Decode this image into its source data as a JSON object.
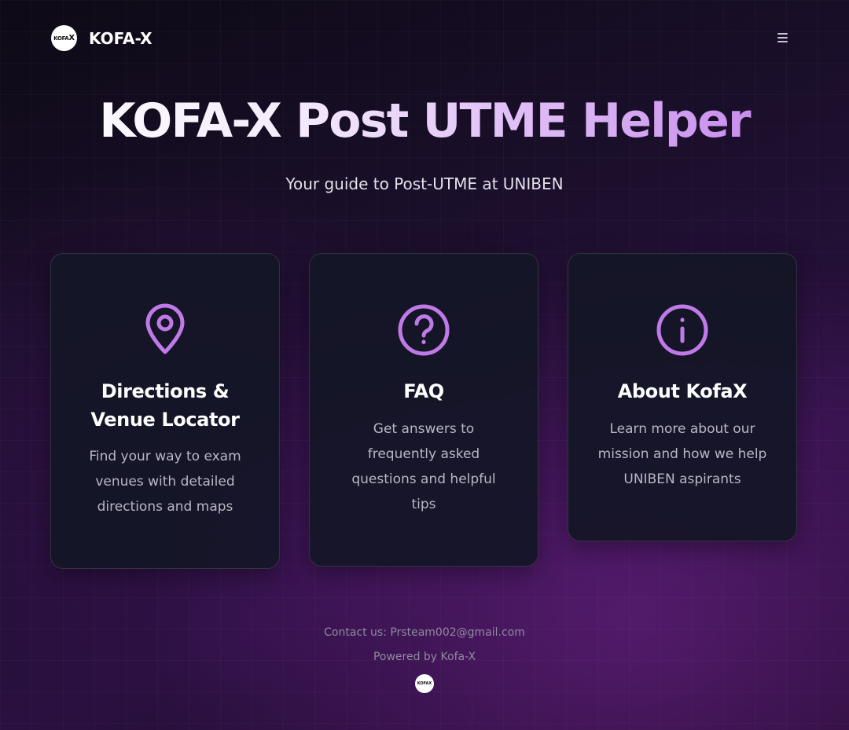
{
  "header": {
    "logo_text": "KOFAX",
    "brand_name": "KOFA-X",
    "menu_icon": "hamburger-menu-icon"
  },
  "hero": {
    "title": "KOFA-X Post UTME Helper",
    "subtitle": "Your guide to Post-UTME at UNIBEN"
  },
  "cards": [
    {
      "icon": "map-pin-icon",
      "title": "Directions & Venue Locator",
      "description": "Find your way to exam venues with detailed directions and maps"
    },
    {
      "icon": "question-circle-icon",
      "title": "FAQ",
      "description": "Get answers to frequently asked questions and helpful tips"
    },
    {
      "icon": "info-circle-icon",
      "title": "About KofaX",
      "description": "Learn more about our mission and how we help UNIBEN aspirants"
    }
  ],
  "footer": {
    "contact": "Contact us: Prsteam002@gmail.com",
    "powered_by": "Powered by Kofa-X",
    "logo_text": "KOFAX"
  },
  "colors": {
    "accent": "#c07ae8",
    "card_bg": "#141626",
    "text_muted": "#b9b6c4",
    "footer_text": "#8f8a9e"
  }
}
